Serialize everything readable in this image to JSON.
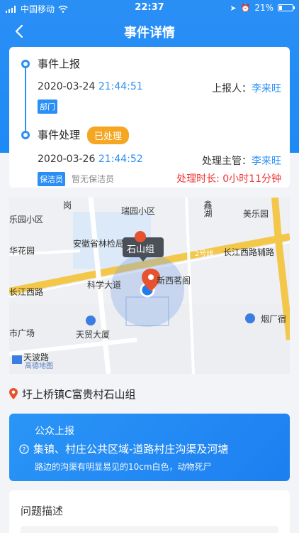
{
  "status_bar": {
    "carrier": "中国移动",
    "time": "22:37",
    "battery": "21%"
  },
  "header": {
    "title": "事件详情"
  },
  "timeline": {
    "report": {
      "title": "事件上报",
      "date": "2020-03-24",
      "time": "21:44:51",
      "reporter_label": "上报人：",
      "reporter": "李来旺",
      "dept_tag": "部门"
    },
    "handle": {
      "title": "事件处理",
      "status": "已处理",
      "date": "2020-03-26",
      "time": "21:44:52",
      "manager_label": "处理主管：",
      "manager": "李来旺",
      "cleaner_tag": "保洁员",
      "cleaner_note": "暂无保洁员",
      "duration": "处理时长: 0小时11分钟"
    }
  },
  "map": {
    "labels": {
      "ruiyuan": "瑞园小区",
      "xinhu": "鑫湖",
      "meile": "美乐园",
      "leyuan": "乐园小区",
      "lingang": "岗",
      "anhui": "安徽省林检局",
      "huayuan": "华花园",
      "shishan": "石山组",
      "road2": "2号线",
      "changjiang_west_aux": "长江西路辅路",
      "changjiang_west": "长江西路",
      "kexue": "科学大道",
      "xinxi": "新西茗阁",
      "yancang": "烟厂宿",
      "shiguang": "市广场",
      "tianmao": "天贸大厦",
      "tianbo": "天波路",
      "logo": "高德地图"
    }
  },
  "address": "圩上桥镇C富贵村石山组",
  "public": {
    "title": "公众上报",
    "category": "集镇、村庄公共区域-道路村庄沟渠及河塘",
    "desc": "路边的沟渠有明显易见的10cm白色，动物死尸"
  },
  "problem": {
    "title": "问题描述"
  }
}
